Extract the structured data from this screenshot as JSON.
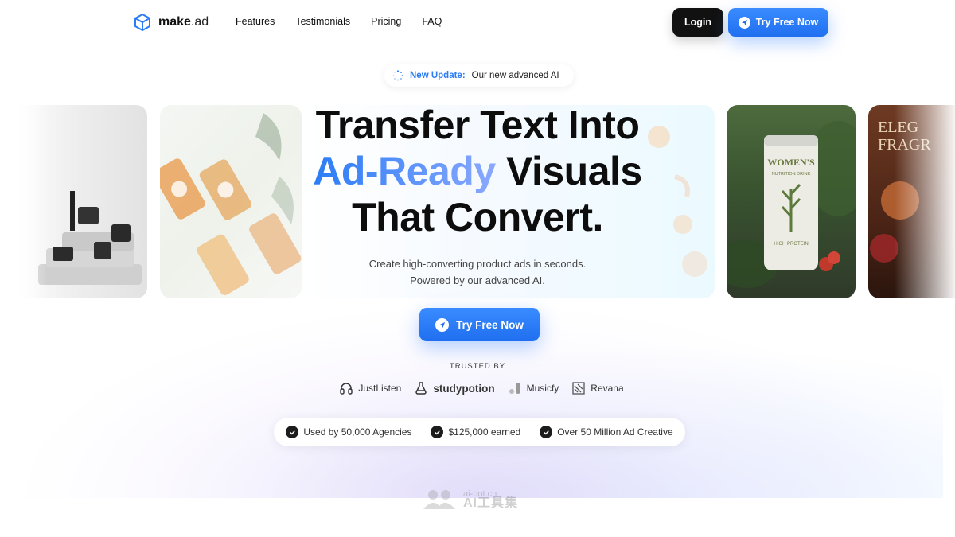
{
  "brand": {
    "name_bold": "make",
    "name_rest": ".ad",
    "accent_color": "#2a7cf6"
  },
  "nav": {
    "links": [
      "Features",
      "Testimonials",
      "Pricing",
      "FAQ"
    ],
    "login_label": "Login",
    "try_label": "Try Free Now"
  },
  "update": {
    "strong": "New Update:",
    "text": "Our new advanced AI"
  },
  "hero": {
    "line1": "Transfer Text Into",
    "line2_accent": "Ad-Ready",
    "line2_rest": "Visuals",
    "line3": "That Convert.",
    "sub1": "Create high-converting product ads in seconds.",
    "sub2": "Powered by our advanced AI."
  },
  "cta": {
    "label": "Try Free Now"
  },
  "trusted": {
    "label": "TRUSTED BY",
    "brands": [
      "JustListen",
      "studypotion",
      "Musicfy",
      "Revana"
    ]
  },
  "stats": [
    "Used by 50,000 Agencies",
    "$125,000 earned",
    "Over 50 Million Ad Creative"
  ],
  "cards": {
    "card4_title": "WOMEN'S",
    "card4_sub": "NUTRITION DRINK",
    "card4_badge": "HIGH PROTEIN",
    "card5_title1": "ELEG",
    "card5_title2": "FRAGR"
  },
  "watermark": {
    "line1": "ai-bot.cn",
    "line2": "AI工具集"
  }
}
